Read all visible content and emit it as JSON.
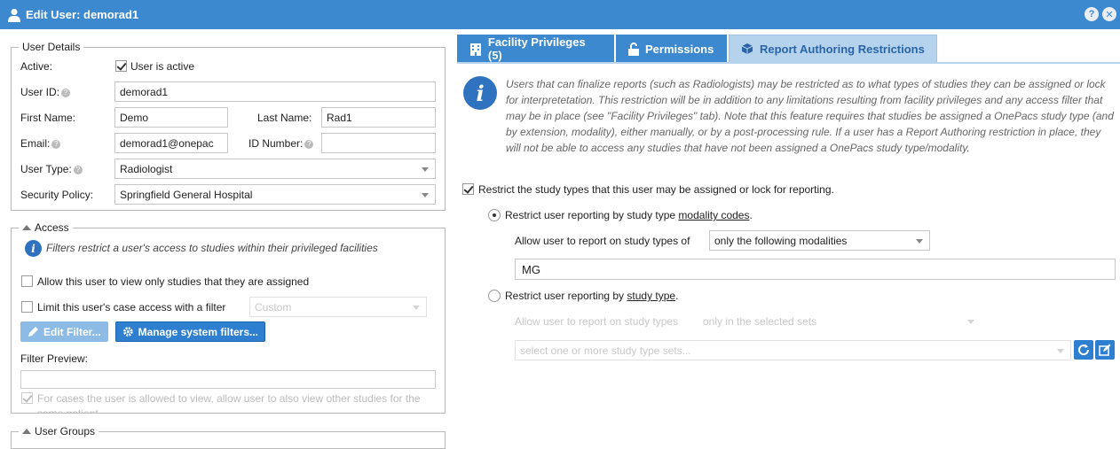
{
  "window": {
    "title": "Edit User: demorad1",
    "help_label": "?",
    "close_label": "✕"
  },
  "user_details": {
    "legend": "User Details",
    "active_label": "Active:",
    "active_checkbox_label": "User is active",
    "user_id_label": "User ID:",
    "user_id_value": "demorad1",
    "first_name_label": "First Name:",
    "first_name_value": "Demo",
    "last_name_label": "Last Name:",
    "last_name_value": "Rad1",
    "email_label": "Email:",
    "email_value": "demorad1@onepac",
    "id_number_label": "ID Number:",
    "id_number_value": "",
    "user_type_label": "User Type:",
    "user_type_value": "Radiologist",
    "security_policy_label": "Security Policy:",
    "security_policy_value": "Springfield General Hospital"
  },
  "access": {
    "legend": "Access",
    "info_text": "Filters restrict a user's access to studies within their privileged facilities",
    "allow_assigned_label": "Allow this user to view only studies that they are assigned",
    "limit_filter_label": "Limit this user's case access with a filter",
    "filter_select_value": "Custom",
    "edit_filter_label": "Edit Filter...",
    "manage_filters_label": "Manage system filters...",
    "filter_preview_label": "Filter Preview:",
    "other_studies_label": "For cases the user is allowed to view, allow user to also view other studies for the same patient"
  },
  "user_groups": {
    "legend": "User Groups"
  },
  "tabs": [
    {
      "label": "Facility Privileges (5)",
      "icon": "building-icon"
    },
    {
      "label": "Permissions",
      "icon": "unlock-icon"
    },
    {
      "label": "Report Authoring Restrictions",
      "icon": "cube-icon"
    }
  ],
  "restrictions": {
    "description": "Users that can finalize reports (such as Radiologists) may be restricted as to what types of studies they can be assigned or lock for interpretetation. This restriction will be in addition to any limitations resulting from facility privileges and any access filter that may be in place (see \"Facility Privileges\" tab). Note that this feature requires that studies be assigned a OnePacs study type (and by extension, modality), either manually, or by a post-processing rule. If a user has a Report Authoring restriction in place, they will not be able to access any studies that have not been assigned a OnePacs study type/modality.",
    "restrict_checkbox_label": "Restrict the study types that this user may be assigned or lock for reporting.",
    "by_modality_prefix": "Restrict user reporting by study type ",
    "by_modality_link": "modality codes",
    "by_modality_suffix": ".",
    "allow_report_label": "Allow user to report on study types of",
    "modality_mode_value": "only the following modalities",
    "modality_value": "MG",
    "by_study_type_prefix": "Restrict user reporting by ",
    "by_study_type_link": "study type",
    "by_study_type_suffix": ".",
    "allow_report_label_2": "Allow user to report on study types",
    "study_type_mode_value": "only in the selected sets",
    "study_type_sets_placeholder": "select one or more study type sets..."
  }
}
